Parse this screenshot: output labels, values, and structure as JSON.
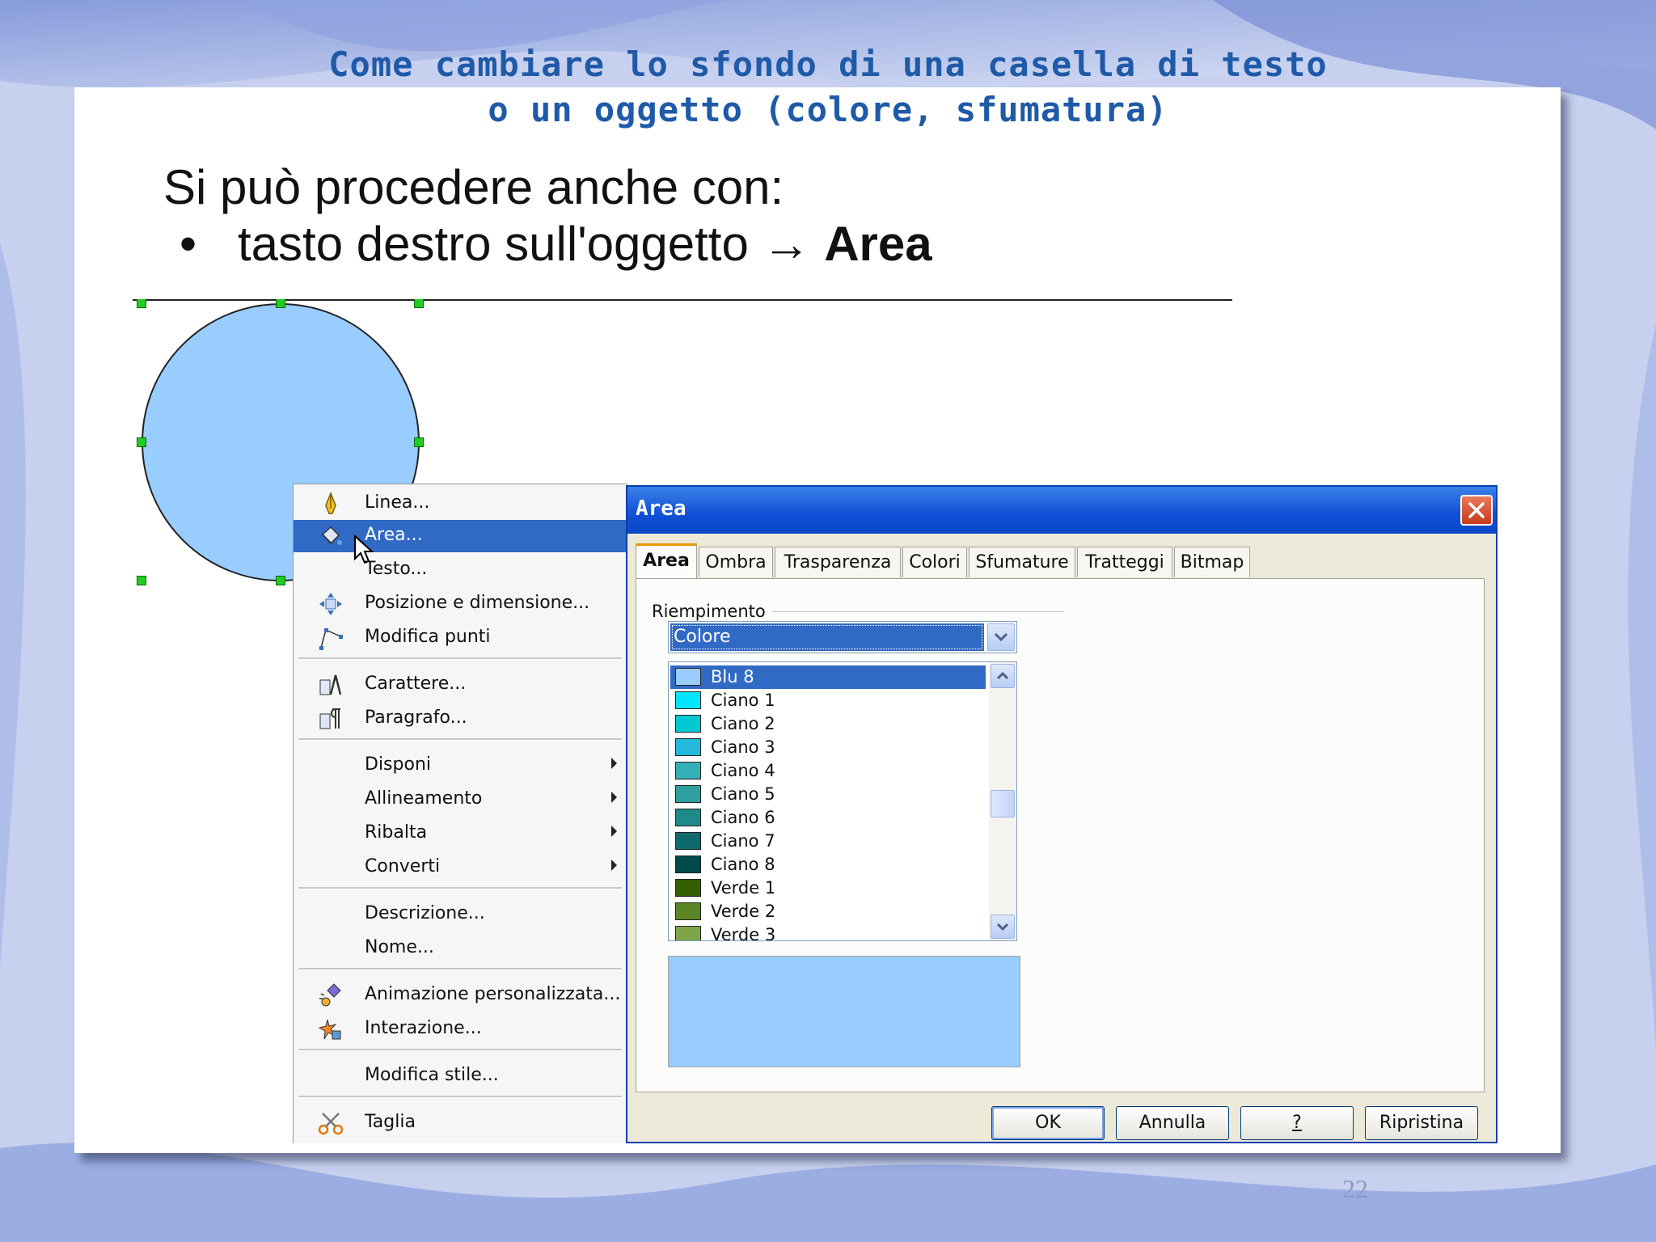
{
  "slide": {
    "title_line1": "Come cambiare lo sfondo di una casella di testo",
    "title_line2": "o un oggetto (colore, sfumatura)",
    "intro": "Si può procedere anche con:",
    "bullet": "•",
    "bullet_text": "tasto destro sull'oggetto → ",
    "bullet_bold": "Area",
    "page_number": "22"
  },
  "shape": {
    "fill_color": "#99ccff"
  },
  "context_menu": {
    "items": [
      {
        "label": "Linea...",
        "icon": "pen-icon"
      },
      {
        "label": "Area...",
        "icon": "paint-bucket-icon",
        "selected": true
      },
      {
        "label": "Testo...",
        "icon": ""
      },
      {
        "label": "Posizione e dimensione...",
        "icon": "move-resize-icon"
      },
      {
        "label": "Modifica punti",
        "icon": "edit-points-icon"
      },
      {
        "label": "Carattere...",
        "icon": "character-icon"
      },
      {
        "label": "Paragrafo...",
        "icon": "paragraph-icon"
      },
      {
        "label": "Disponi",
        "submenu": true
      },
      {
        "label": "Allineamento",
        "submenu": true
      },
      {
        "label": "Ribalta",
        "submenu": true
      },
      {
        "label": "Converti",
        "submenu": true
      },
      {
        "label": "Descrizione..."
      },
      {
        "label": "Nome..."
      },
      {
        "label": "Animazione personalizzata...",
        "icon": "animation-icon"
      },
      {
        "label": "Interazione...",
        "icon": "interaction-icon"
      },
      {
        "label": "Modifica stile..."
      },
      {
        "label": "Taglia",
        "icon": "scissors-icon"
      }
    ]
  },
  "dialog": {
    "title": "Area",
    "tabs": [
      "Area",
      "Ombra",
      "Trasparenza",
      "Colori",
      "Sfumature",
      "Tratteggi",
      "Bitmap"
    ],
    "active_tab": "Area",
    "fill_label": "Riempimento",
    "fill_type": "Colore",
    "colors": [
      {
        "name": "Blu 8",
        "color": "#99ccff",
        "selected": true
      },
      {
        "name": "Ciano 1",
        "color": "#00e5ff"
      },
      {
        "name": "Ciano 2",
        "color": "#00c8d2"
      },
      {
        "name": "Ciano 3",
        "color": "#23b8dc"
      },
      {
        "name": "Ciano 4",
        "color": "#33b0b5"
      },
      {
        "name": "Ciano 5",
        "color": "#2fa0a0"
      },
      {
        "name": "Ciano 6",
        "color": "#1e8a8a"
      },
      {
        "name": "Ciano 7",
        "color": "#0f6a6e"
      },
      {
        "name": "Ciano 8",
        "color": "#004a4a"
      },
      {
        "name": "Verde 1",
        "color": "#355e00"
      },
      {
        "name": "Verde 2",
        "color": "#5c8526"
      },
      {
        "name": "Verde 3",
        "color": "#7ea54a"
      }
    ],
    "preview_color": "#99ccff",
    "buttons": {
      "ok": "OK",
      "cancel": "Annulla",
      "help": "?",
      "reset": "Ripristina"
    }
  }
}
